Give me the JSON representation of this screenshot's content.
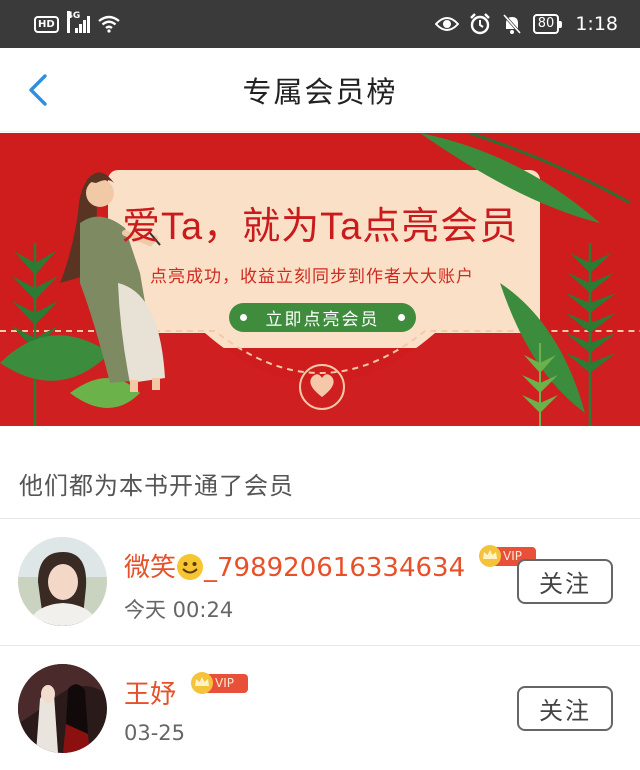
{
  "status_bar": {
    "hd": "HD",
    "network": "4G",
    "battery": "80",
    "time": "1:18"
  },
  "header": {
    "title": "专属会员榜"
  },
  "banner": {
    "title": "爱Ta，就为Ta点亮会员",
    "subtitle": "点亮成功，收益立刻同步到作者大大账户",
    "button": "立即点亮会员"
  },
  "section": {
    "title": "他们都为本书开通了会员"
  },
  "members": [
    {
      "name": "微笑",
      "name_suffix": "_798920616334634",
      "badge": "VIP",
      "time": "今天 00:24",
      "follow": "关注"
    },
    {
      "name": "王妤",
      "badge": "VIP",
      "time": "03-25",
      "follow": "关注"
    }
  ],
  "colors": {
    "banner_red": "#cf1d1e",
    "name_orange": "#e8502a",
    "button_green": "#3f8c3c",
    "accent_blue": "#2f8ee0"
  }
}
